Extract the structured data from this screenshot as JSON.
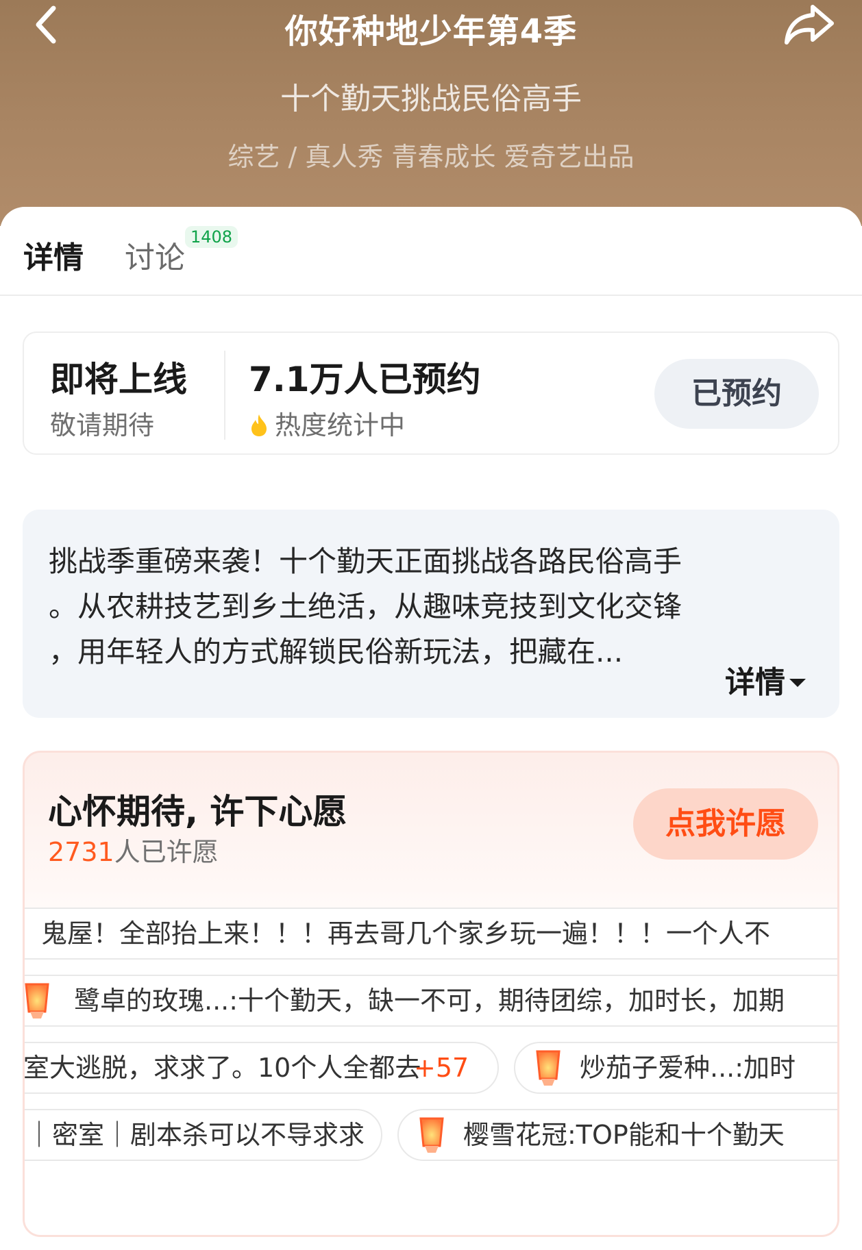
{
  "header": {
    "title": "你好种地少年第4季",
    "subtitle": "十个勤天挑战民俗高手",
    "tags": "综艺 / 真人秀 青春成长 爱奇艺出品"
  },
  "tabs": {
    "detail": "详情",
    "discuss": "讨论",
    "discuss_badge": "1408"
  },
  "status": {
    "title": "即将上线",
    "subtitle": "敬请期待",
    "reserve_count": "7.1万人已预约",
    "heat": "热度统计中",
    "reserved_button": "已预约"
  },
  "description": {
    "lines": [
      "挑战季重磅来袭！十个勤天正面挑战各路民俗高手",
      "。从农耕技艺到乡土绝活，从趣味竞技到文化交锋",
      "，用年轻人的方式解锁民俗新玩法，把藏在..."
    ],
    "more": "详情"
  },
  "wish": {
    "title": "心怀期待, 许下心愿",
    "count": "2731",
    "count_suffix": "人已许愿",
    "button": "点我许愿",
    "danmu": [
      {
        "text": "鬼屋！全部抬上来！！！再去哥几个家乡玩一遍！！！一个人不"
      },
      {
        "text": "鹭卓的玫瑰...:十个勤天，缺一不可，期待团综，加时长，加期"
      },
      {
        "text": "室大逃脱，求求了。10个人全都去",
        "plus": "+57"
      },
      {
        "text": "炒茄子爱种...:加时"
      },
      {
        "text": "｜密室｜剧本杀可以不导求求"
      },
      {
        "text": "樱雪花冠:TOP能和十个勤天"
      }
    ]
  },
  "colors": {
    "accent": "#ff4d14",
    "badge_green": "#10a34a",
    "hero_bg": "#a98563"
  }
}
